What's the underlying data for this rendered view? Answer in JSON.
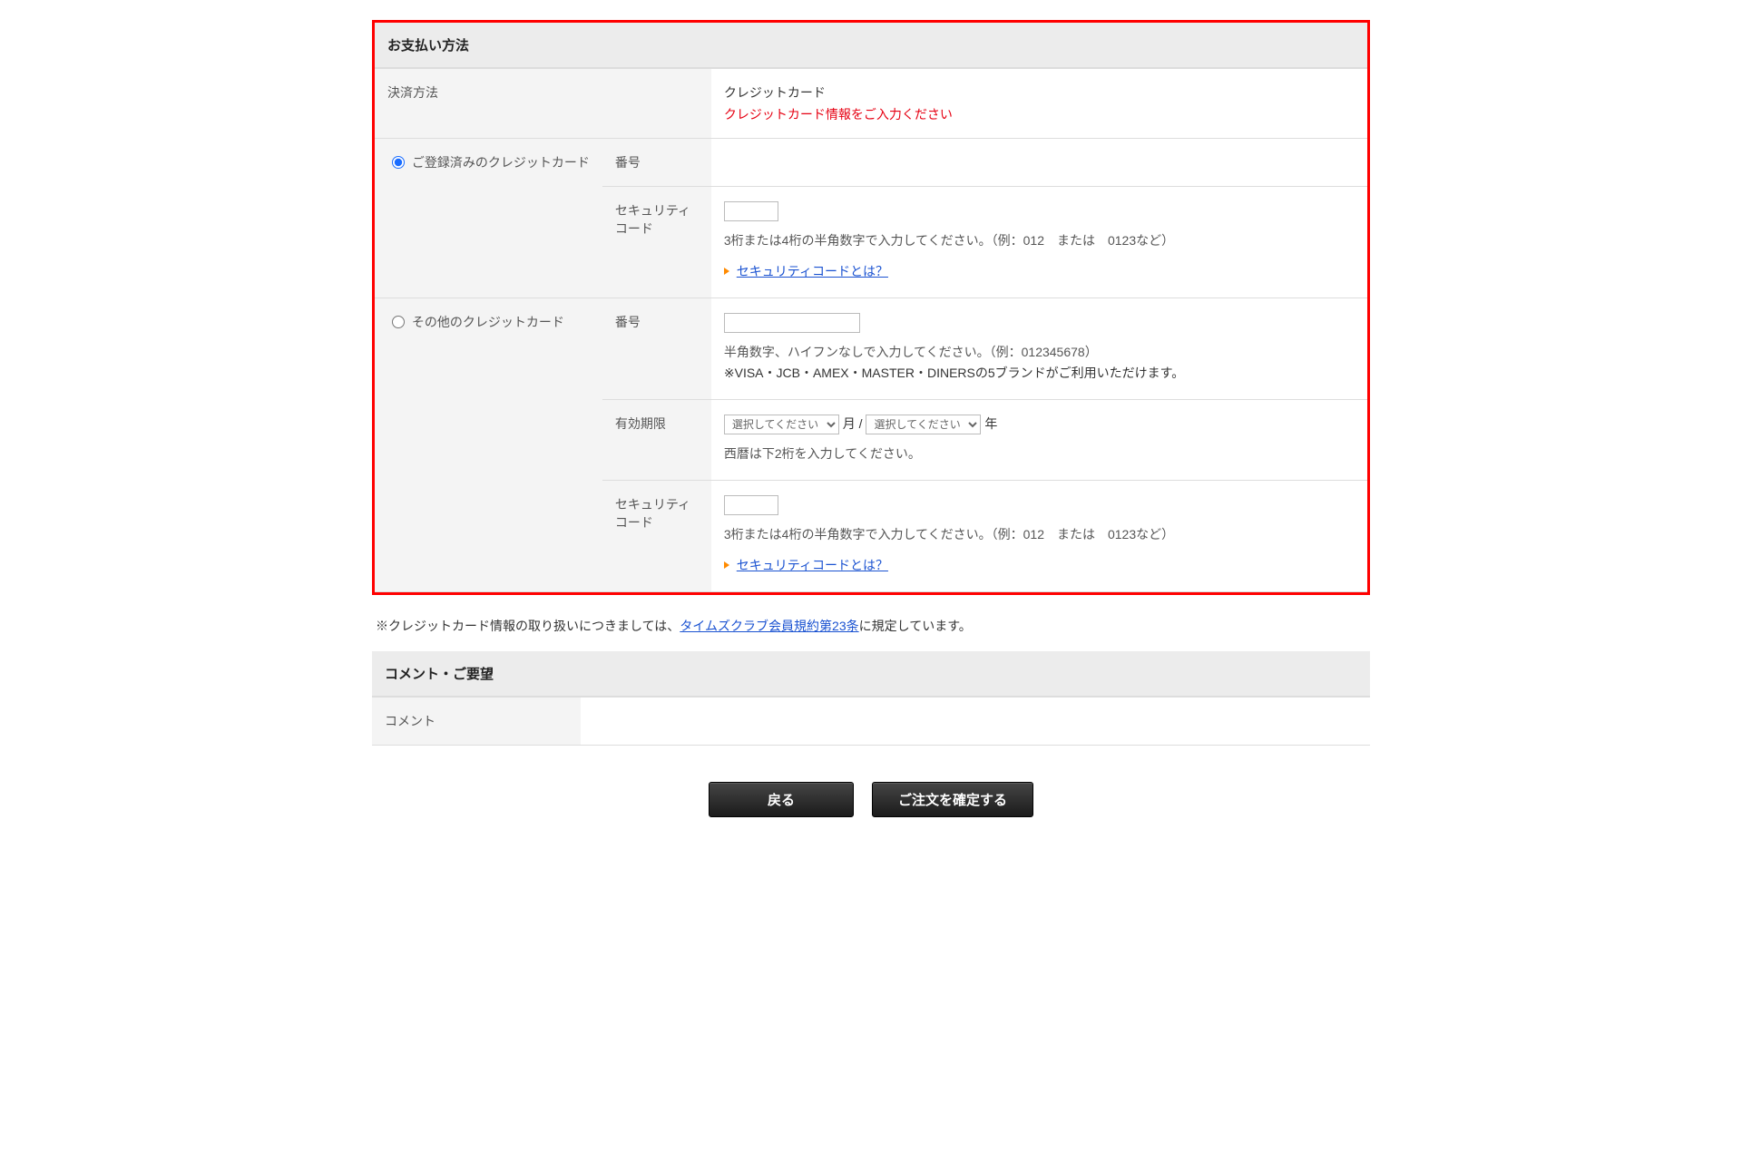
{
  "payment": {
    "section_title": "お支払い方法",
    "method_label": "決済方法",
    "method_value": "クレジットカード",
    "method_note": "クレジットカード情報をご入力ください",
    "registered": {
      "radio_label": "ご登録済みのクレジットカード",
      "number_label": "番号",
      "security_label": "セキュリティコード",
      "security_help": "3桁または4桁の半角数字で入力してください。（例：012　または　0123など）",
      "security_link": "セキュリティコードとは？"
    },
    "other": {
      "radio_label": "その他のクレジットカード",
      "number_label": "番号",
      "number_help1": "半角数字、ハイフンなしで入力してください。（例：012345678）",
      "number_help2": "※VISA・JCB・AMEX・MASTER・DINERSの5ブランドがご利用いただけます。",
      "expiry_label": "有効期限",
      "expiry_placeholder": "選択してください",
      "expiry_month_suffix": "月 /",
      "expiry_year_suffix": "年",
      "expiry_help": "西暦は下2桁を入力してください。",
      "security_label": "セキュリティコード",
      "security_help": "3桁または4桁の半角数字で入力してください。（例：012　または　0123など）",
      "security_link": "セキュリティコードとは？"
    }
  },
  "footnote": {
    "prefix": "※クレジットカード情報の取り扱いにつきましては、",
    "link": "タイムズクラブ会員規約第23条",
    "suffix": "に規定しています。"
  },
  "comment": {
    "section_title": "コメント・ご要望",
    "label": "コメント"
  },
  "buttons": {
    "back": "戻る",
    "confirm": "ご注文を確定する"
  }
}
